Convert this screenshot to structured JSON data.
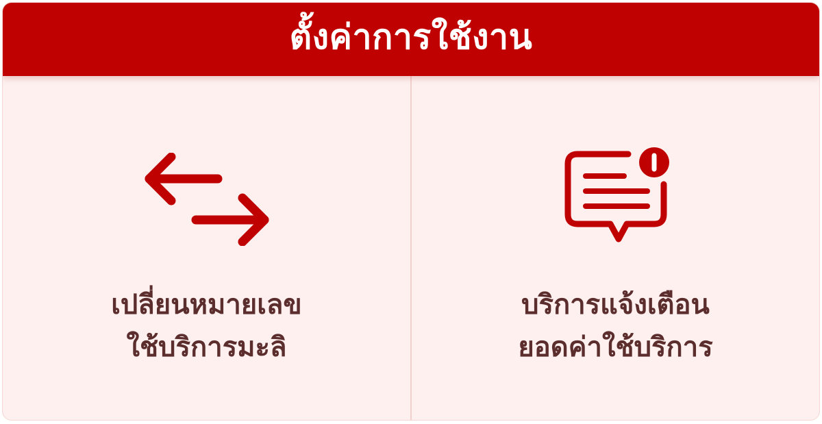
{
  "header": {
    "title": "ตั้งค่าการใช้งาน"
  },
  "panels": [
    {
      "icon": "swap-arrows-icon",
      "line1": "เปลี่ยนหมายเลข",
      "line2": "ใช้บริการมะลิ"
    },
    {
      "icon": "message-alert-icon",
      "line1": "บริการแจ้งเตือน",
      "line2": "ยอดค่าใช้บริการ"
    }
  ],
  "colors": {
    "brand_red": "#c00101",
    "panel_bg": "#fdf0ef",
    "text": "#5b2d2d",
    "divider": "#f4d0cc"
  }
}
